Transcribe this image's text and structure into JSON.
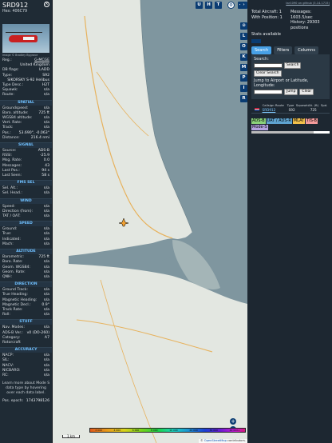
{
  "info": {
    "callsign": "SRD912",
    "hex_label": "Hex:",
    "hex": "406C79",
    "close_glyph": "×",
    "photo_credit": "Image © Bradley Bygrave",
    "rows_top": [
      {
        "k": "Reg.:",
        "v": "G-MCGE"
      },
      {
        "k": "",
        "v": "United Kingdom"
      },
      {
        "k": "DB flags:",
        "v": "LADD"
      },
      {
        "k": "Type:",
        "v": "S92"
      },
      {
        "k": "",
        "v": "SIKORSKY S-92 Helibus"
      },
      {
        "k": "Type Desc.:",
        "v": "H2T"
      },
      {
        "k": "Squawk:",
        "v": "n/a"
      },
      {
        "k": "Route:",
        "v": "n/a"
      }
    ],
    "spatial_title": "SPATIAL",
    "spatial": [
      {
        "k": "Groundspeed:",
        "v": "n/a"
      },
      {
        "k": "Baro. altitude:",
        "v": "725 ft"
      },
      {
        "k": "WGS84 altitude:",
        "v": "n/a"
      },
      {
        "k": "Vert. Rate:",
        "v": "n/a"
      },
      {
        "k": "Track:",
        "v": "n/a"
      },
      {
        "k": "Pos.:",
        "v": "53.690°, -0.063°"
      },
      {
        "k": "Distance:",
        "v": "216.4 nmi"
      }
    ],
    "signal_title": "SIGNAL",
    "signal": [
      {
        "k": "Source:",
        "v": "ADS-B"
      },
      {
        "k": "RSSI:",
        "v": "-25.9"
      },
      {
        "k": "Msg. Rate:",
        "v": "0.0"
      },
      {
        "k": "Messages:",
        "v": "43"
      },
      {
        "k": "Last Pos.:",
        "v": "94 s"
      },
      {
        "k": "Last Seen:",
        "v": "58 s"
      }
    ],
    "fms_title": "FMS SEL",
    "fms": [
      {
        "k": "Sel. Alt.:",
        "v": "n/a"
      },
      {
        "k": "Sel. Head.:",
        "v": "n/a"
      }
    ],
    "wind_title": "WIND",
    "wind": [
      {
        "k": "Speed:",
        "v": "n/a"
      },
      {
        "k": "Direction (from):",
        "v": "n/a"
      },
      {
        "k": "TAT / OAT:",
        "v": "n/a"
      }
    ],
    "speed_title": "SPEED",
    "speed": [
      {
        "k": "Ground:",
        "v": "n/a"
      },
      {
        "k": "True:",
        "v": "n/a"
      },
      {
        "k": "Indicated:",
        "v": "n/a"
      },
      {
        "k": "Mach:",
        "v": "n/a"
      }
    ],
    "altitude_title": "ALTITUDE",
    "altitude": [
      {
        "k": "Barometric:",
        "v": "725 ft"
      },
      {
        "k": "Baro. Rate:",
        "v": "n/a"
      },
      {
        "k": "Geom. WGS84:",
        "v": "n/a"
      },
      {
        "k": "Geom. Rate:",
        "v": "n/a"
      },
      {
        "k": "QNH:",
        "v": "n/a"
      }
    ],
    "direction_title": "DIRECTION",
    "direction": [
      {
        "k": "Ground Track:",
        "v": "n/a"
      },
      {
        "k": "True Heading:",
        "v": "n/a"
      },
      {
        "k": "Magnetic Heading:",
        "v": "n/a"
      },
      {
        "k": "Magnetic Decl.:",
        "v": "0.9°"
      },
      {
        "k": "Track Rate:",
        "v": "n/a"
      },
      {
        "k": "Roll:",
        "v": "n/a"
      }
    ],
    "stuff_title": "STUFF",
    "stuff": [
      {
        "k": "Nav. Modes:",
        "v": "n/a"
      },
      {
        "k": "ADS-B Ver.:",
        "v": "v0 (DO-260)"
      },
      {
        "k": "Category:",
        "v": "A7"
      },
      {
        "k": "Rotorcraft",
        "v": ""
      }
    ],
    "accuracy_title": "ACCURACY",
    "accuracy": [
      {
        "k": "NACP:",
        "v": "n/a"
      },
      {
        "k": "SIL:",
        "v": "n/a"
      },
      {
        "k": "NACV:",
        "v": "n/a"
      },
      {
        "k": "NICBARO:",
        "v": "n/a"
      },
      {
        "k": "RC:",
        "v": "n/a"
      }
    ],
    "note": "Learn more about Mode S data type by hovering over each data label.",
    "epoch_label": "Pos. epoch:",
    "epoch": "1743798126"
  },
  "map": {
    "top_buttons": [
      "U",
      "H",
      "T"
    ],
    "settings_glyph": "⚙",
    "collapse_glyph": "◂▸",
    "zoom_in": "+",
    "zoom_out": "−",
    "scale_label": "1 km",
    "colorbar_ticks": [
      "2 000",
      "4 000",
      "6 000",
      "8 000",
      "10 000",
      "20 000",
      "30 000",
      "40 000+"
    ],
    "attribution_prefix": "© ",
    "attribution_link": "OpenStreetMap",
    "attribution_suffix": " contributors."
  },
  "toggles": [
    "›",
    "⊙",
    "L",
    "O",
    "K",
    "M",
    "P",
    "I",
    "R"
  ],
  "sidebar": {
    "github_link": "tar1090 on github (3.14.1715)",
    "stats": {
      "total_label": "Total Aircraft: 1",
      "position_label": "With Position: 1",
      "messages_label": "Messages:",
      "messages_value": "1603.5/sec",
      "history_label": "History: 29303",
      "history_unit": "positions"
    },
    "stats_available": "Stats available",
    "tabs": [
      "Search",
      "Filters",
      "Columns"
    ],
    "search_label": "Search:",
    "search_button": "Search",
    "clear_search": "Clear Search",
    "jump_label": "Jump to Airport or Latitude, Longitude:",
    "jump_button": "Jump",
    "clear_button": "Clear",
    "columns": [
      "",
      "Callsign",
      "Route",
      "Type",
      "Squawk",
      "Alt. (ft)",
      "Spd."
    ],
    "rows": [
      {
        "callsign": "SRD912",
        "route": "",
        "type": "S92",
        "squawk": "",
        "alt": "725",
        "spd": ""
      }
    ],
    "legend": [
      {
        "label": "ADS-B",
        "color": "#8ad17a"
      },
      {
        "label": "UAT / ADS-R",
        "color": "#5fa3d0"
      },
      {
        "label": "MLAT",
        "color": "#f2c04b"
      },
      {
        "label": "TIS-B",
        "color": "#f49b9b"
      },
      {
        "label": "Mode-S",
        "color": "#b4a2e0"
      }
    ]
  }
}
